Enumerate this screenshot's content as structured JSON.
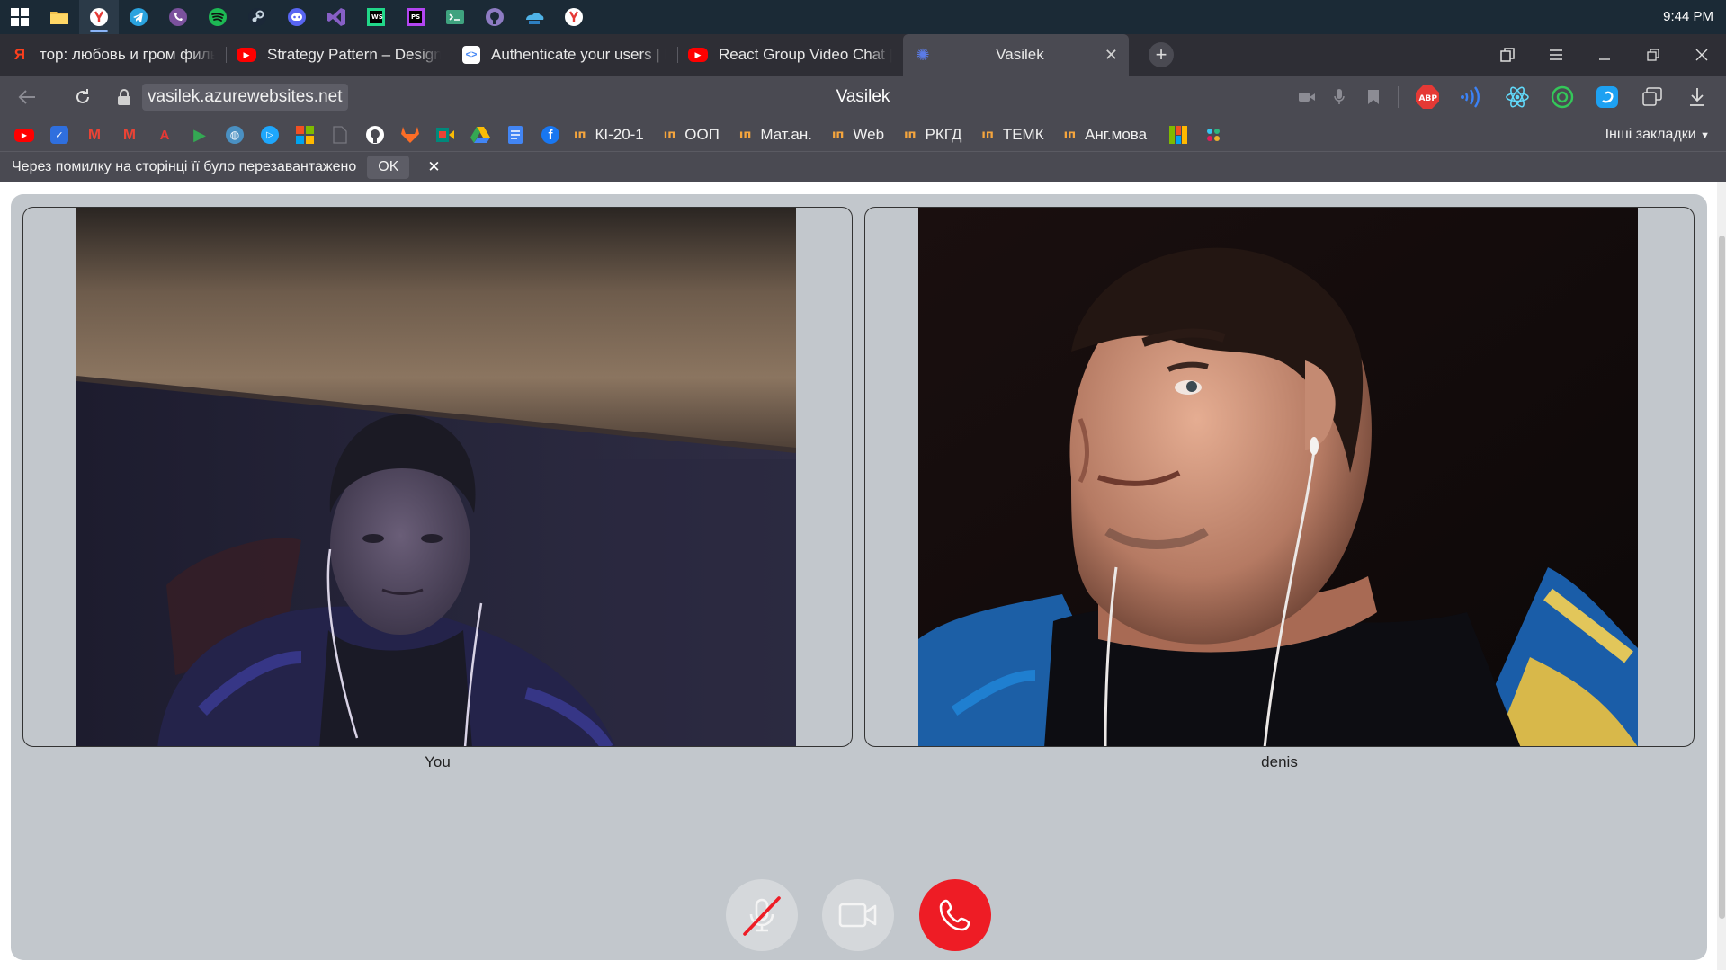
{
  "taskbar": {
    "icons": [
      {
        "name": "windows-start-icon",
        "color": "#ffffff"
      },
      {
        "name": "file-explorer-icon",
        "color": "#f2c14e"
      },
      {
        "name": "yandex-browser-icon",
        "color": "#e53935",
        "active": true
      },
      {
        "name": "telegram-icon",
        "color": "#2aa3df"
      },
      {
        "name": "viber-icon",
        "color": "#7b519d"
      },
      {
        "name": "spotify-icon",
        "color": "#1db954"
      },
      {
        "name": "steam-icon",
        "color": "#c7d5e0"
      },
      {
        "name": "discord-icon",
        "color": "#5865f2"
      },
      {
        "name": "visual-studio-icon",
        "color": "#865fc5"
      },
      {
        "name": "webstorm-icon",
        "color": "#21d789"
      },
      {
        "name": "phpstorm-icon",
        "color": "#b345f1"
      },
      {
        "name": "terminal-icon",
        "color": "#3fa37f"
      },
      {
        "name": "github-desktop-icon",
        "color": "#8e7cc3"
      },
      {
        "name": "azure-data-studio-icon",
        "color": "#4fb3e8"
      },
      {
        "name": "yandex-icon",
        "color": "#e53935"
      }
    ],
    "clock": "9:44 PM"
  },
  "tabs": [
    {
      "title": "тор: любовь и гром фильм",
      "favicon": "yandex-favicon",
      "favicon_color": "#fc3f1d",
      "favicon_glyph": "Я",
      "active": false
    },
    {
      "title": "Strategy Pattern – Design Patterns",
      "favicon": "youtube-favicon",
      "favicon_color": "#ff0000",
      "favicon_glyph": "▶",
      "active": false
    },
    {
      "title": "Authenticate your users | Firebase",
      "favicon": "docs-favicon",
      "favicon_color": "#ffffff",
      "favicon_glyph": "<>",
      "active": false
    },
    {
      "title": "React Group Video Chat | simple-peer",
      "favicon": "youtube-favicon",
      "favicon_color": "#ff0000",
      "favicon_glyph": "▶",
      "active": false
    },
    {
      "title": "Vasilek",
      "favicon": "vasilek-favicon",
      "favicon_color": "#3b5bd6",
      "favicon_glyph": "✺",
      "active": true
    }
  ],
  "browser": {
    "url": "vasilek.azurewebsites.net",
    "page_title": "Vasilek",
    "extensions": [
      {
        "name": "camera-indicator-icon"
      },
      {
        "name": "microphone-indicator-icon"
      },
      {
        "name": "bookmark-icon"
      },
      {
        "name": "adblock-plus-icon",
        "label": "ABP",
        "color": "#e53935"
      },
      {
        "name": "wifi-extension-icon",
        "color": "#3b82f6"
      },
      {
        "name": "react-devtools-icon",
        "color": "#61dafb"
      },
      {
        "name": "circle-extension-icon",
        "color": "#34c759"
      },
      {
        "name": "edge-translate-icon",
        "color": "#1da1f2"
      },
      {
        "name": "collections-icon"
      },
      {
        "name": "downloads-icon"
      }
    ]
  },
  "bookmarks": {
    "icons": [
      {
        "name": "youtube-bookmark-icon",
        "color": "#ff0000",
        "glyph": "▶"
      },
      {
        "name": "chart-bookmark-icon",
        "color": "#2f6fde",
        "glyph": "✓"
      },
      {
        "name": "gmail-bookmark-icon",
        "color": "#ea4335",
        "glyph": "M"
      },
      {
        "name": "gmail-bookmark-icon-2",
        "color": "#ea4335",
        "glyph": "M"
      },
      {
        "name": "translate-bookmark-icon",
        "color": "#e53935",
        "glyph": "A"
      },
      {
        "name": "play-bookmark-icon",
        "color": "#34a853",
        "glyph": "▶"
      },
      {
        "name": "globe-bookmark-icon",
        "color": "#4a90c2",
        "glyph": "◍"
      },
      {
        "name": "media-bookmark-icon",
        "color": "#1ea7fd",
        "glyph": "▷"
      },
      {
        "name": "office-bookmark-icon",
        "color": "#f25022",
        "glyph": "■"
      },
      {
        "name": "blank-bookmark-icon",
        "color": "#5d5d66",
        "glyph": ""
      },
      {
        "name": "github-bookmark-icon",
        "color": "#ffffff",
        "glyph": "●"
      },
      {
        "name": "gitlab-bookmark-icon",
        "color": "#fc6d26",
        "glyph": "◆"
      },
      {
        "name": "meet-bookmark-icon",
        "color": "#00897b",
        "glyph": "▣"
      },
      {
        "name": "drive-bookmark-icon",
        "color": "#fbbc04",
        "glyph": "▲"
      },
      {
        "name": "docs-bookmark-icon",
        "color": "#4285f4",
        "glyph": "≡"
      },
      {
        "name": "facebook-bookmark-icon",
        "color": "#1877f2",
        "glyph": "f"
      }
    ],
    "folders": [
      "КІ-20-1",
      "ООП",
      "Мат.ан.",
      "Web",
      "РКГД",
      "ТЕМК",
      "Анг.мова"
    ],
    "trailing_icons": [
      {
        "name": "windows-apps-bookmark-icon",
        "color": "#7fba00"
      },
      {
        "name": "slack-bookmark-icon",
        "color": "#e01e5a"
      }
    ],
    "other": "Інші закладки"
  },
  "infobar": {
    "message": "Через помилку на сторінці її було перезавантажено",
    "ok_label": "OK",
    "close_glyph": "✕"
  },
  "call": {
    "participants": [
      {
        "label": "You"
      },
      {
        "label": "denis"
      }
    ],
    "controls": {
      "mic_muted": true,
      "mic_color": "#ee1c25",
      "hangup_color": "#ee1c25"
    }
  }
}
